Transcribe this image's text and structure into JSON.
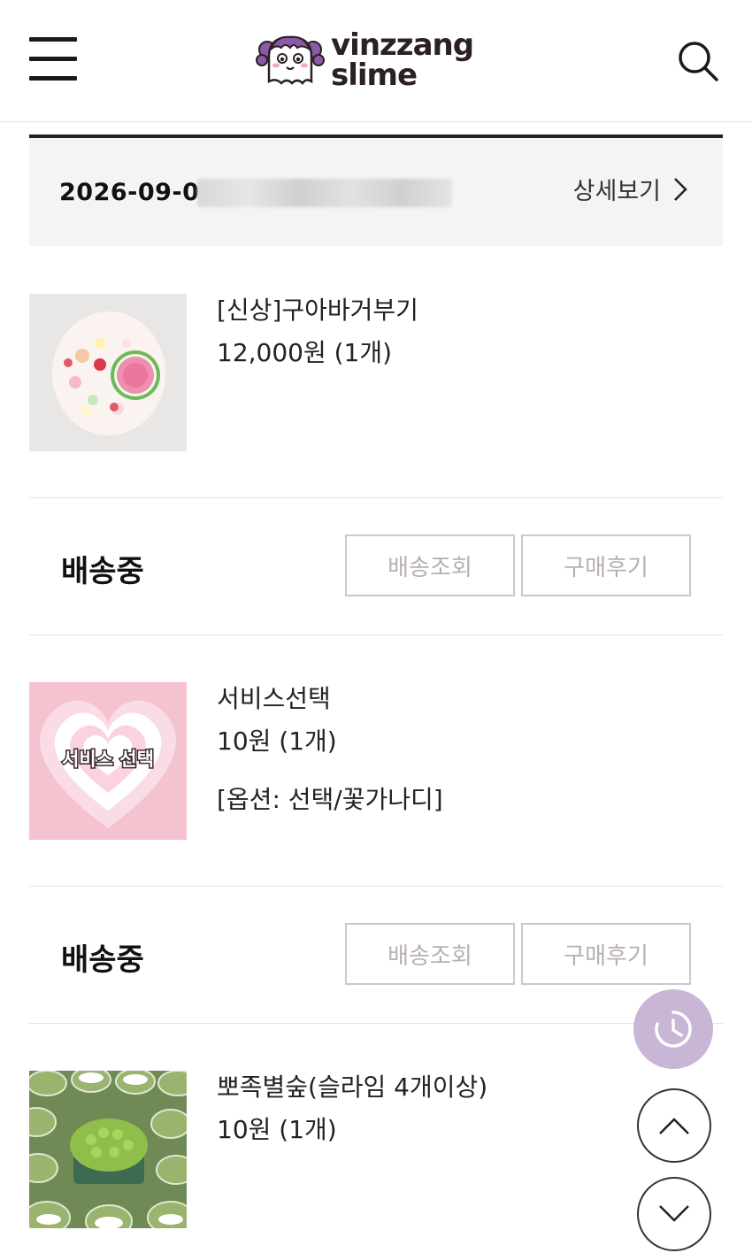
{
  "header": {
    "logo_line1": "vinzzang",
    "logo_line2": "slime",
    "menu_icon": "hamburger-menu-icon",
    "search_icon": "search-icon"
  },
  "order": {
    "date": "2026-09-0(",
    "detail_label": "상세보기"
  },
  "items": [
    {
      "name": "[신상]구아바거부기",
      "price": "12,000원 (1개)",
      "status": "배송중",
      "track_label": "배송조회",
      "review_label": "구매후기"
    },
    {
      "name": "서비스선택",
      "price": "10원 (1개)",
      "option": "[옵션: 선택/꽃가나디]",
      "thumb_text": "서비스 선택",
      "status": "배송중",
      "track_label": "배송조회",
      "review_label": "구매후기"
    },
    {
      "name": "뽀족별숲(슬라임 4개이상)",
      "price": "10원 (1개)"
    }
  ],
  "floating": {
    "recent_icon": "clock-icon",
    "up_icon": "chevron-up-icon",
    "down_icon": "chevron-down-icon"
  },
  "colors": {
    "accent": "#c9b5d5",
    "button_border": "#cfc6d0",
    "button_text": "#b7aeb8"
  }
}
